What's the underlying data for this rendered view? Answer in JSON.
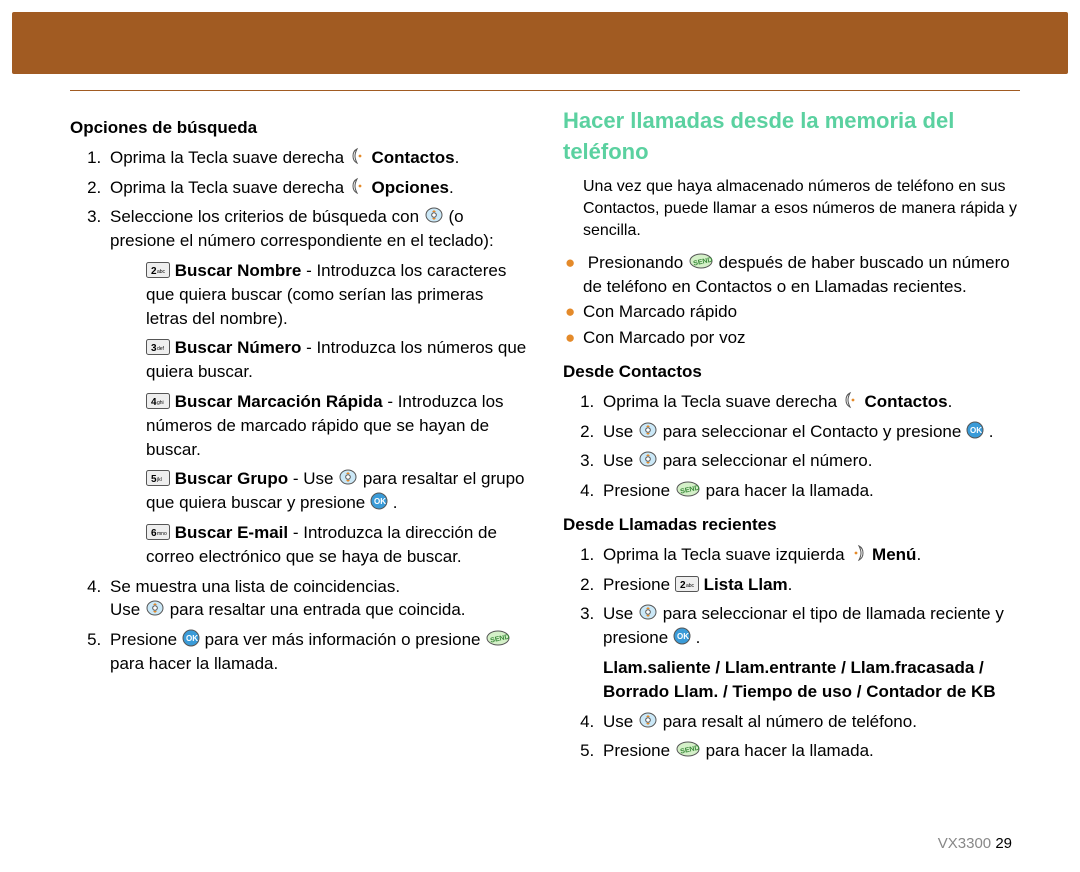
{
  "left": {
    "heading": "Opciones de búsqueda",
    "step1a": "Oprima la Tecla suave derecha",
    "step1b": "Contactos",
    "step2a": "Oprima la Tecla suave derecha",
    "step2b": "Opciones",
    "step3a": "Seleccione los criterios de búsqueda con",
    "step3b": "(o presione el número correspondiente en el teclado):",
    "opt1_bold": "Buscar Nombre",
    "opt1_rest": " - Introduzca los caracteres que quiera buscar (como serían las primeras letras del nombre).",
    "opt2_bold": "Buscar Número",
    "opt2_rest": " - Introduzca los números que quiera buscar.",
    "opt3_bold": "Buscar Marcación Rápida",
    "opt3_rest": " - Introduzca los números de marcado rápido que se hayan de buscar.",
    "opt4_bold": "Buscar Grupo",
    "opt4_rest_a": " - Use ",
    "opt4_rest_b": " para resaltar el grupo que quiera buscar y presione ",
    "opt5_bold": "Buscar E-mail",
    "opt5_rest": " - Introduzca la dirección de correo electrónico que se haya de buscar.",
    "step4a": "Se muestra una lista de coincidencias.",
    "step4b": "Use ",
    "step4c": " para resaltar una entrada que coincida.",
    "step5a": "Presione ",
    "step5b": " para ver más información o presione ",
    "step5c": " para hacer la llamada."
  },
  "right": {
    "title": "Hacer llamadas desde la memoria del teléfono",
    "intro": "Una vez que haya almacenado números de teléfono en sus Contactos, puede llamar a esos números de manera rápida y sencilla.",
    "b1a": "Presionando ",
    "b1b": " después de haber buscado un número de teléfono en Contactos o en Llamadas recientes.",
    "b2": "Con Marcado rápido",
    "b3": "Con Marcado por voz",
    "sub1": "Desde Contactos",
    "c1a": "Oprima la Tecla suave derecha ",
    "c1b": "Contactos",
    "c2a": "Use ",
    "c2b": " para seleccionar el Contacto y presione ",
    "c3a": "Use ",
    "c3b": " para seleccionar el número.",
    "c4a": "Presione ",
    "c4b": " para hacer la llamada.",
    "sub2": "Desde Llamadas recientes",
    "r1a": "Oprima la Tecla suave izquierda ",
    "r1b": "Menú",
    "r2a": "Presione ",
    "r2b": "Lista Llam",
    "r3a": "Use ",
    "r3b": " para seleccionar el tipo de llamada reciente y presione ",
    "r_bold": "Llam.saliente / Llam.entrante / Llam.fracasada / Borrado Llam. / Tiempo de uso / Contador de KB",
    "r4a": "Use ",
    "r4b": " para resalt al número de teléfono.",
    "r5a": "Presione ",
    "r5b": " para hacer la llamada."
  },
  "footer": {
    "model": "VX3300",
    "page": "29"
  }
}
